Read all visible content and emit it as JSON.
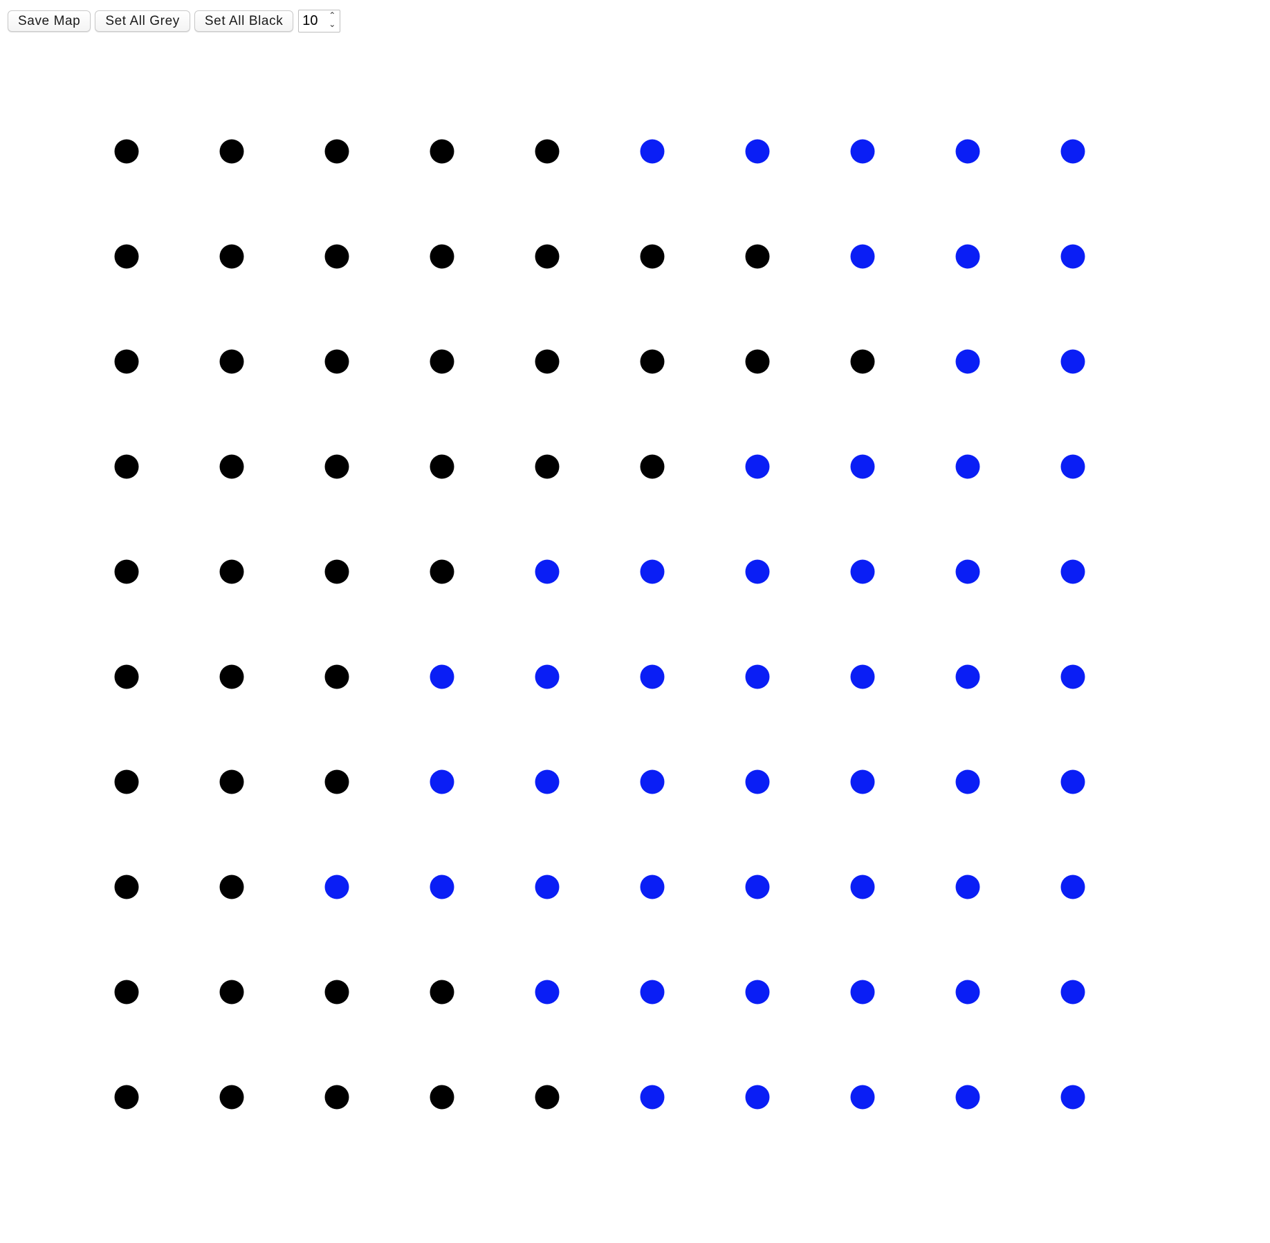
{
  "toolbar": {
    "save_label": "Save Map",
    "set_grey_label": "Set All Grey",
    "set_black_label": "Set All Black",
    "grid_size_value": "10"
  },
  "colors": {
    "black": "#000000",
    "blue": "#0a1ef5",
    "grey": "#808080"
  },
  "grid": {
    "rows": 10,
    "cols": 10,
    "cells": [
      [
        "black",
        "black",
        "black",
        "black",
        "black",
        "blue",
        "blue",
        "blue",
        "blue",
        "blue"
      ],
      [
        "black",
        "black",
        "black",
        "black",
        "black",
        "black",
        "black",
        "blue",
        "blue",
        "blue"
      ],
      [
        "black",
        "black",
        "black",
        "black",
        "black",
        "black",
        "black",
        "black",
        "blue",
        "blue"
      ],
      [
        "black",
        "black",
        "black",
        "black",
        "black",
        "black",
        "blue",
        "blue",
        "blue",
        "blue"
      ],
      [
        "black",
        "black",
        "black",
        "black",
        "blue",
        "blue",
        "blue",
        "blue",
        "blue",
        "blue"
      ],
      [
        "black",
        "black",
        "black",
        "blue",
        "blue",
        "blue",
        "blue",
        "blue",
        "blue",
        "blue"
      ],
      [
        "black",
        "black",
        "black",
        "blue",
        "blue",
        "blue",
        "blue",
        "blue",
        "blue",
        "blue"
      ],
      [
        "black",
        "black",
        "blue",
        "blue",
        "blue",
        "blue",
        "blue",
        "blue",
        "blue",
        "blue"
      ],
      [
        "black",
        "black",
        "black",
        "black",
        "blue",
        "blue",
        "blue",
        "blue",
        "blue",
        "blue"
      ],
      [
        "black",
        "black",
        "black",
        "black",
        "black",
        "blue",
        "blue",
        "blue",
        "blue",
        "blue"
      ]
    ]
  }
}
